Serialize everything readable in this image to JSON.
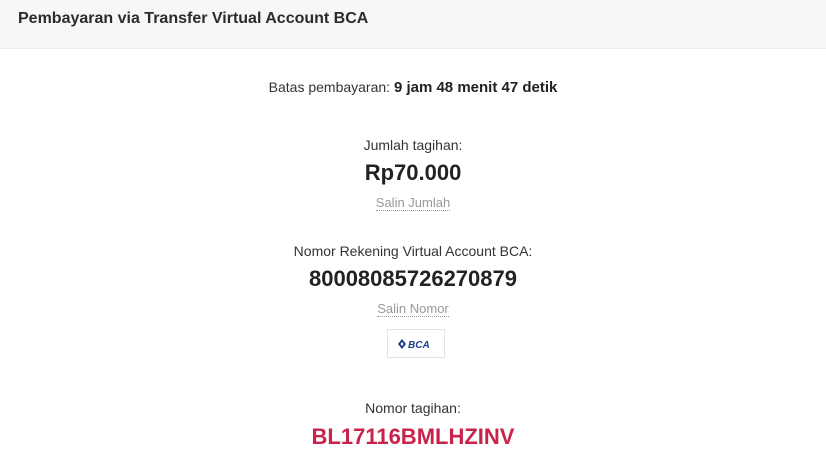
{
  "header": {
    "title": "Pembayaran via Transfer Virtual Account BCA"
  },
  "deadline": {
    "label": "Batas pembayaran: ",
    "value": "9 jam 48 menit 47 detik"
  },
  "amount": {
    "label": "Jumlah tagihan:",
    "value": "Rp70.000",
    "copy_label": "Salin Jumlah"
  },
  "account": {
    "label": "Nomor Rekening Virtual Account BCA:",
    "value": "80008085726270879",
    "copy_label": "Salin Nomor"
  },
  "bank": {
    "logo_text": "BCA",
    "logo_icon": "bca-logo-icon",
    "brand_color": "#1a3f8f"
  },
  "invoice": {
    "label": "Nomor tagihan:",
    "value": "BL17116BMLHZINV",
    "color": "#c8234d"
  }
}
